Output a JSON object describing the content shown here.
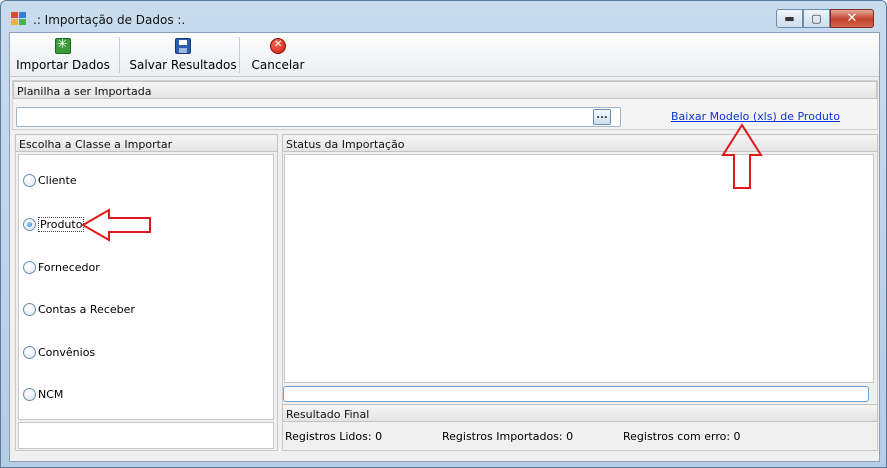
{
  "window": {
    "title": ".: Importação de Dados :.",
    "controls": {
      "minimize": "▬",
      "maximize": "▢",
      "close": "✕"
    }
  },
  "toolbar": {
    "buttons": [
      {
        "label": "Importar Dados",
        "icon": "import-icon"
      },
      {
        "label": "Salvar Resultados",
        "icon": "save-icon"
      },
      {
        "label": "Cancelar",
        "icon": "cancel-icon"
      }
    ]
  },
  "planilha": {
    "header": "Planilha a ser Importada",
    "path_value": "",
    "browse_label": "...",
    "download_link": "Baixar Modelo (xls) de Produto"
  },
  "classe": {
    "header": "Escolha a Classe a Importar",
    "options": [
      {
        "label": "Cliente",
        "checked": false
      },
      {
        "label": "Produto",
        "checked": true
      },
      {
        "label": "Fornecedor",
        "checked": false
      },
      {
        "label": "Contas a Receber",
        "checked": false
      },
      {
        "label": "Convênios",
        "checked": false
      },
      {
        "label": "NCM",
        "checked": false
      }
    ]
  },
  "status": {
    "header": "Status da Importação",
    "log": "",
    "progress": 0
  },
  "resultado": {
    "header": "Resultado Final",
    "lidos_label": "Registros Lidos:",
    "lidos_value": "0",
    "importados_label": "Registros Importados:",
    "importados_value": "0",
    "erro_label": "Registros com erro:",
    "erro_value": "0"
  },
  "colors": {
    "annotation_arrow": "#e0191c",
    "link": "#0b34d6",
    "progress_border": "#6aa0cf"
  }
}
